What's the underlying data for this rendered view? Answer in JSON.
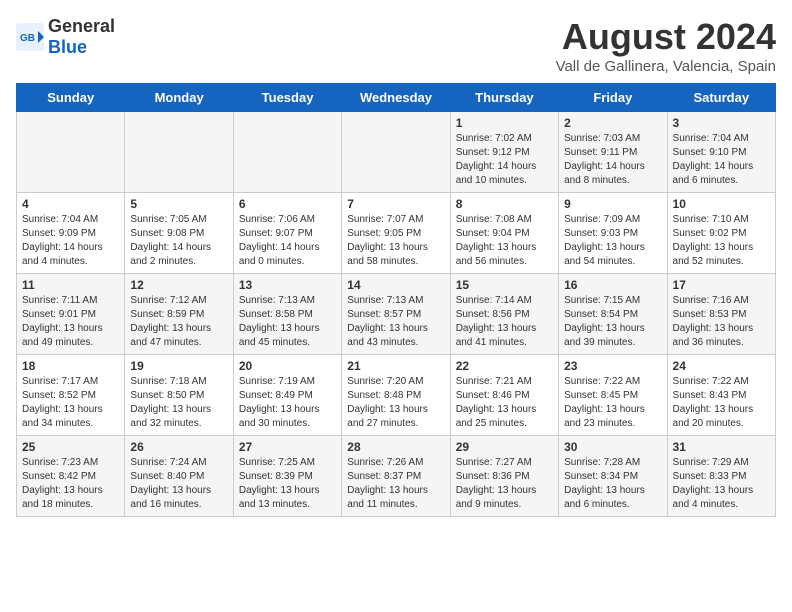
{
  "header": {
    "logo_general": "General",
    "logo_blue": "Blue",
    "main_title": "August 2024",
    "sub_title": "Vall de Gallinera, Valencia, Spain"
  },
  "days_of_week": [
    "Sunday",
    "Monday",
    "Tuesday",
    "Wednesday",
    "Thursday",
    "Friday",
    "Saturday"
  ],
  "weeks": [
    [
      {
        "day": "",
        "text": ""
      },
      {
        "day": "",
        "text": ""
      },
      {
        "day": "",
        "text": ""
      },
      {
        "day": "",
        "text": ""
      },
      {
        "day": "1",
        "text": "Sunrise: 7:02 AM\nSunset: 9:12 PM\nDaylight: 14 hours\nand 10 minutes."
      },
      {
        "day": "2",
        "text": "Sunrise: 7:03 AM\nSunset: 9:11 PM\nDaylight: 14 hours\nand 8 minutes."
      },
      {
        "day": "3",
        "text": "Sunrise: 7:04 AM\nSunset: 9:10 PM\nDaylight: 14 hours\nand 6 minutes."
      }
    ],
    [
      {
        "day": "4",
        "text": "Sunrise: 7:04 AM\nSunset: 9:09 PM\nDaylight: 14 hours\nand 4 minutes."
      },
      {
        "day": "5",
        "text": "Sunrise: 7:05 AM\nSunset: 9:08 PM\nDaylight: 14 hours\nand 2 minutes."
      },
      {
        "day": "6",
        "text": "Sunrise: 7:06 AM\nSunset: 9:07 PM\nDaylight: 14 hours\nand 0 minutes."
      },
      {
        "day": "7",
        "text": "Sunrise: 7:07 AM\nSunset: 9:05 PM\nDaylight: 13 hours\nand 58 minutes."
      },
      {
        "day": "8",
        "text": "Sunrise: 7:08 AM\nSunset: 9:04 PM\nDaylight: 13 hours\nand 56 minutes."
      },
      {
        "day": "9",
        "text": "Sunrise: 7:09 AM\nSunset: 9:03 PM\nDaylight: 13 hours\nand 54 minutes."
      },
      {
        "day": "10",
        "text": "Sunrise: 7:10 AM\nSunset: 9:02 PM\nDaylight: 13 hours\nand 52 minutes."
      }
    ],
    [
      {
        "day": "11",
        "text": "Sunrise: 7:11 AM\nSunset: 9:01 PM\nDaylight: 13 hours\nand 49 minutes."
      },
      {
        "day": "12",
        "text": "Sunrise: 7:12 AM\nSunset: 8:59 PM\nDaylight: 13 hours\nand 47 minutes."
      },
      {
        "day": "13",
        "text": "Sunrise: 7:13 AM\nSunset: 8:58 PM\nDaylight: 13 hours\nand 45 minutes."
      },
      {
        "day": "14",
        "text": "Sunrise: 7:13 AM\nSunset: 8:57 PM\nDaylight: 13 hours\nand 43 minutes."
      },
      {
        "day": "15",
        "text": "Sunrise: 7:14 AM\nSunset: 8:56 PM\nDaylight: 13 hours\nand 41 minutes."
      },
      {
        "day": "16",
        "text": "Sunrise: 7:15 AM\nSunset: 8:54 PM\nDaylight: 13 hours\nand 39 minutes."
      },
      {
        "day": "17",
        "text": "Sunrise: 7:16 AM\nSunset: 8:53 PM\nDaylight: 13 hours\nand 36 minutes."
      }
    ],
    [
      {
        "day": "18",
        "text": "Sunrise: 7:17 AM\nSunset: 8:52 PM\nDaylight: 13 hours\nand 34 minutes."
      },
      {
        "day": "19",
        "text": "Sunrise: 7:18 AM\nSunset: 8:50 PM\nDaylight: 13 hours\nand 32 minutes."
      },
      {
        "day": "20",
        "text": "Sunrise: 7:19 AM\nSunset: 8:49 PM\nDaylight: 13 hours\nand 30 minutes."
      },
      {
        "day": "21",
        "text": "Sunrise: 7:20 AM\nSunset: 8:48 PM\nDaylight: 13 hours\nand 27 minutes."
      },
      {
        "day": "22",
        "text": "Sunrise: 7:21 AM\nSunset: 8:46 PM\nDaylight: 13 hours\nand 25 minutes."
      },
      {
        "day": "23",
        "text": "Sunrise: 7:22 AM\nSunset: 8:45 PM\nDaylight: 13 hours\nand 23 minutes."
      },
      {
        "day": "24",
        "text": "Sunrise: 7:22 AM\nSunset: 8:43 PM\nDaylight: 13 hours\nand 20 minutes."
      }
    ],
    [
      {
        "day": "25",
        "text": "Sunrise: 7:23 AM\nSunset: 8:42 PM\nDaylight: 13 hours\nand 18 minutes."
      },
      {
        "day": "26",
        "text": "Sunrise: 7:24 AM\nSunset: 8:40 PM\nDaylight: 13 hours\nand 16 minutes."
      },
      {
        "day": "27",
        "text": "Sunrise: 7:25 AM\nSunset: 8:39 PM\nDaylight: 13 hours\nand 13 minutes."
      },
      {
        "day": "28",
        "text": "Sunrise: 7:26 AM\nSunset: 8:37 PM\nDaylight: 13 hours\nand 11 minutes."
      },
      {
        "day": "29",
        "text": "Sunrise: 7:27 AM\nSunset: 8:36 PM\nDaylight: 13 hours\nand 9 minutes."
      },
      {
        "day": "30",
        "text": "Sunrise: 7:28 AM\nSunset: 8:34 PM\nDaylight: 13 hours\nand 6 minutes."
      },
      {
        "day": "31",
        "text": "Sunrise: 7:29 AM\nSunset: 8:33 PM\nDaylight: 13 hours\nand 4 minutes."
      }
    ]
  ]
}
